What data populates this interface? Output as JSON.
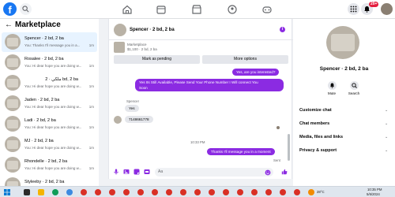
{
  "top_nav": {
    "logo": "f",
    "notif_badge": "20+",
    "icons": [
      "search-icon",
      "home-icon",
      "watch-icon",
      "marketplace-icon",
      "groups-icon",
      "gaming-icon",
      "menu-grid-icon",
      "messenger-icon",
      "bell-icon"
    ]
  },
  "left_panel": {
    "title": "Marketplace",
    "back_icon": "←",
    "conversations": [
      {
        "name": "Spencer · 2 bd, 2 ba",
        "preview": "You: Thanks I'll message you in a...",
        "time": "1m",
        "active": true
      },
      {
        "name": "Rosalee · 2 bd, 2 ba",
        "preview": "You: Hi dear hope you are doing w...",
        "time": "1m",
        "active": false
      },
      {
        "name": "ملكي · 2 bd, 2 ba",
        "preview": "You: Hi dear hope you are doing w...",
        "time": "1m",
        "active": false
      },
      {
        "name": "Jaden · 2 bd, 2 ba",
        "preview": "You: Hi dear hope you are doing w...",
        "time": "1m",
        "active": false
      },
      {
        "name": "Ladi · 2 bd, 2 ba",
        "preview": "You: Hi dear hope you are doing w...",
        "time": "1m",
        "active": false
      },
      {
        "name": "MJ · 2 bd, 2 ba",
        "preview": "You: Hi dear hope you are doing w...",
        "time": "1m",
        "active": false
      },
      {
        "name": "Rhondelle · 2 bd, 2 ba",
        "preview": "You: Hi dear hope you are doing w...",
        "time": "1m",
        "active": false
      },
      {
        "name": "Styleeby · 2 bd, 2 ba",
        "preview": "",
        "time": "",
        "active": false
      }
    ]
  },
  "chat": {
    "title": "Spencer · 2 bd, 2 ba",
    "info_icon": "i",
    "listing_line1": "Marketplace",
    "listing_line2": "$1,100 · 2 bd, 2 ba",
    "mark_pending": "Mark as pending",
    "more_options": "More options",
    "messages": {
      "out1": "Yes, are you interested?",
      "out2_l1": "Yes Its Still Available, Please Send Your Phone Number I Will connect You",
      "out2_l2": "Soon",
      "sender_name": "Spencer",
      "in1": "Yes",
      "in2": "7148661778",
      "timestamp": "10:33 PM",
      "out3": "Thanks I'll message you in a moment",
      "sent_label": "Sent"
    },
    "composer_placeholder": "Aa"
  },
  "right_panel": {
    "title": "Spencer · 2 bd, 2 ba",
    "mute_label": "Mute",
    "search_label": "Search",
    "sections": [
      "Customize chat",
      "Chat members",
      "Media, files and links",
      "Privacy & support"
    ]
  },
  "taskbar": {
    "weather": "28°C",
    "time": "10:35 PM",
    "date": "5/6/2024"
  },
  "colors": {
    "accent_purple": "#8b2be2",
    "fb_blue": "#1877f2"
  }
}
